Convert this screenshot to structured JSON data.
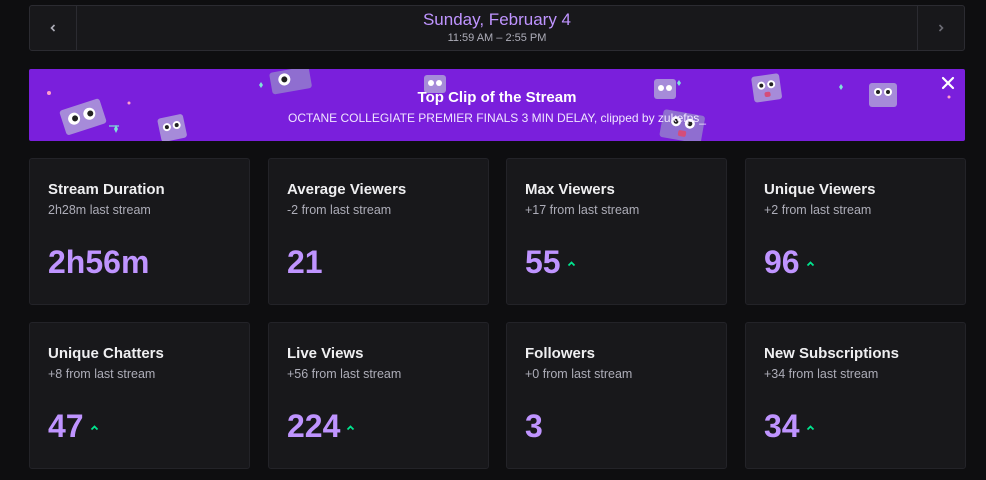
{
  "date_nav": {
    "prev_icon": "chevron-left-icon",
    "next_icon": "chevron-right-icon",
    "title": "Sunday, February 4",
    "time_range": "11:59 AM – 2:55 PM"
  },
  "banner": {
    "title": "Top Clip of the Stream",
    "subtitle": "OCTANE COLLEGIATE PREMIER FINALS 3 MIN DELAY, clipped by zukefps_",
    "close_icon": "close-icon",
    "background": "#7a1fdc"
  },
  "colors": {
    "accent": "#bf94ff",
    "trend_up": "#00e58f"
  },
  "stats": [
    {
      "title": "Stream Duration",
      "sub": "2h28m last stream",
      "value": "2h56m",
      "trend": "none"
    },
    {
      "title": "Average Viewers",
      "sub": "-2 from last stream",
      "value": "21",
      "trend": "none"
    },
    {
      "title": "Max Viewers",
      "sub": "+17 from last stream",
      "value": "55",
      "trend": "up"
    },
    {
      "title": "Unique Viewers",
      "sub": "+2 from last stream",
      "value": "96",
      "trend": "up"
    },
    {
      "title": "Unique Chatters",
      "sub": "+8 from last stream",
      "value": "47",
      "trend": "up"
    },
    {
      "title": "Live Views",
      "sub": "+56 from last stream",
      "value": "224",
      "trend": "up"
    },
    {
      "title": "Followers",
      "sub": "+0 from last stream",
      "value": "3",
      "trend": "none"
    },
    {
      "title": "New Subscriptions",
      "sub": "+34 from last stream",
      "value": "34",
      "trend": "up"
    }
  ]
}
